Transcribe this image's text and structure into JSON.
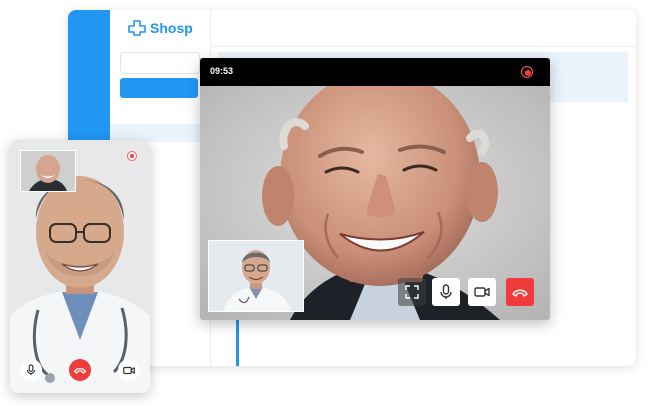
{
  "app": {
    "logo_text": "Shosp",
    "accent_color": "#2196f3"
  },
  "call": {
    "timer": "09:53",
    "recording_indicator": "record-icon",
    "controls": [
      "fullscreen-icon",
      "mic-icon",
      "camera-icon",
      "hangup-icon"
    ],
    "hangup_color": "#ef3b3b"
  },
  "phone": {
    "controls": [
      "mic-icon",
      "hangup-icon",
      "camera-icon"
    ]
  }
}
